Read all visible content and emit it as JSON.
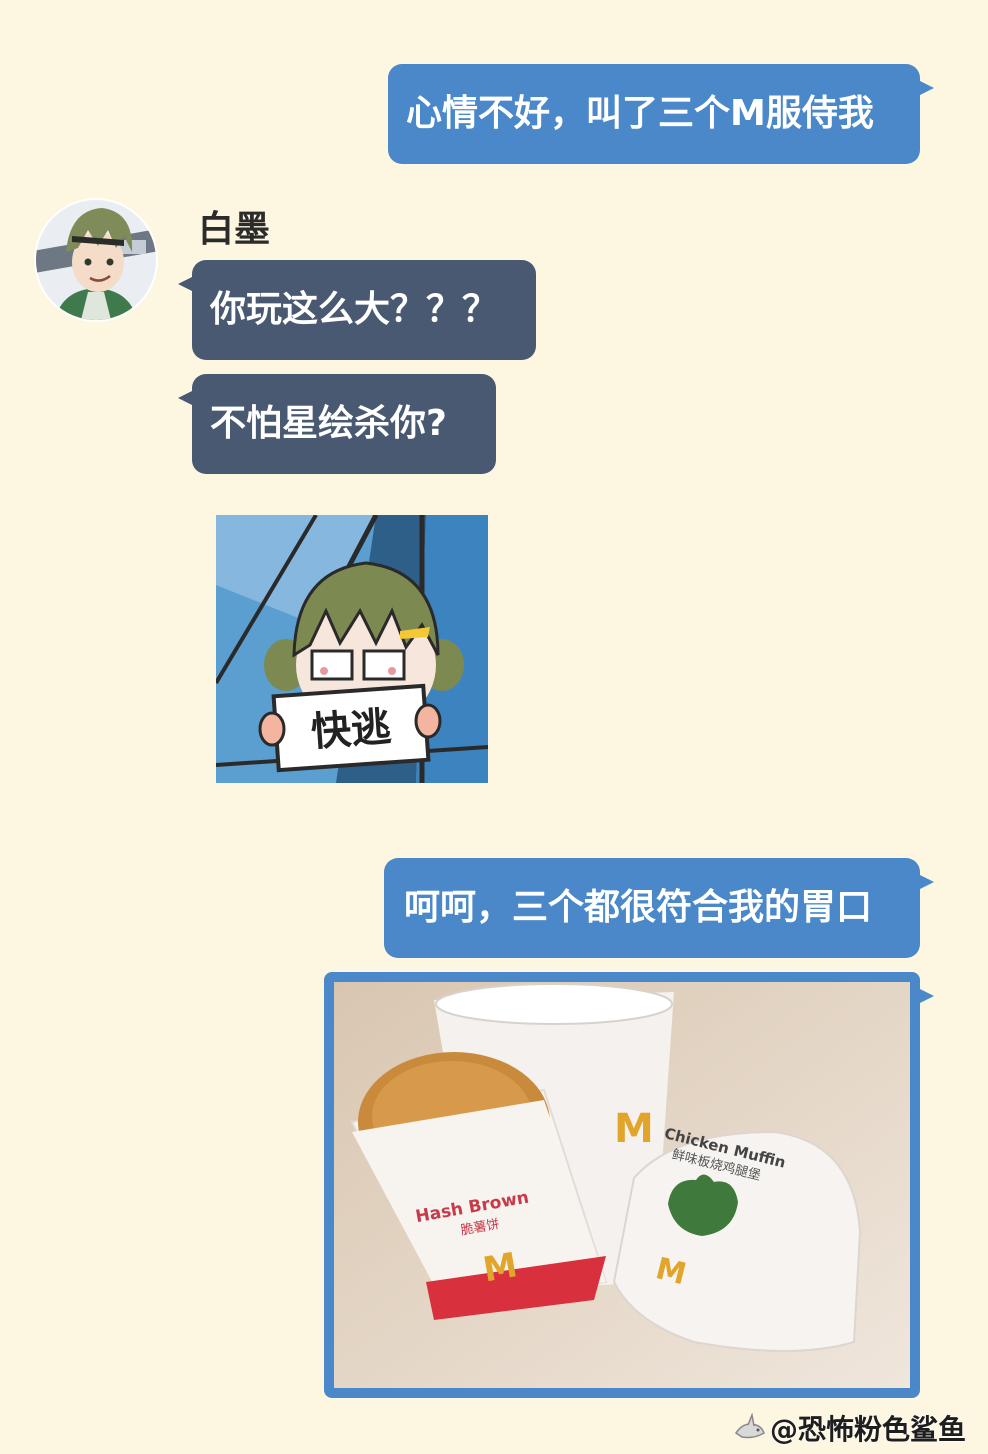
{
  "messages": [
    {
      "side": "right",
      "text": "心情不好，叫了三个M服侍我"
    },
    {
      "side": "left",
      "text": "你玩这么大？？？"
    },
    {
      "side": "left",
      "text": "不怕星绘杀你?"
    },
    {
      "side": "right",
      "text": "呵呵，三个都很符合我的胃口"
    }
  ],
  "contact": {
    "name": "白墨"
  },
  "sticker": {
    "sign_text": "快逃"
  },
  "photo": {
    "hash_brown_label": "Hash Brown",
    "hash_brown_cn": "脆薯饼",
    "muffin_label": "Chicken Muffin",
    "muffin_cn": "鲜味板烧鸡腿堡",
    "brand_mark": "M"
  },
  "watermark": {
    "text": "@恐怖粉色鲨鱼"
  },
  "colors": {
    "background": "#fdf6e1",
    "outgoing": "#4a88c9",
    "incoming": "#4a5972"
  }
}
